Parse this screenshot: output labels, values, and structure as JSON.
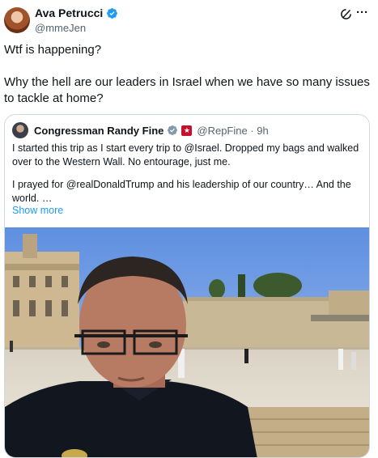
{
  "author": {
    "name": "Ava Petrucci",
    "handle": "@mmeJen",
    "avatar_icon": "user-avatar",
    "verified_icon": "verified-badge-icon",
    "verified_color": "#1d9bf0"
  },
  "tweet": {
    "line1": "Wtf is happening?",
    "line2": "Why the hell are our leaders in Israel when we have so many issues to tackle at home?"
  },
  "quoted": {
    "name": "Congressman Randy Fine",
    "handle_time": "@RepFine · 9h",
    "verified_icon": "verified-badge-gray-icon",
    "affiliation_icon": "flag-badge-icon",
    "paragraph1": "I started this trip as I start every trip to @Israel.  Dropped my bags and walked over to the Western Wall.  No entourage, just me.",
    "paragraph2": "I prayed for @realDonaldTrump and his leadership of our country… And the world. …",
    "show_more": "Show more",
    "link_color": "#1d9bf0"
  },
  "toolbar": {
    "grok_icon": "grok-icon",
    "more_icon": "more-options-icon",
    "more_glyph": "···"
  }
}
